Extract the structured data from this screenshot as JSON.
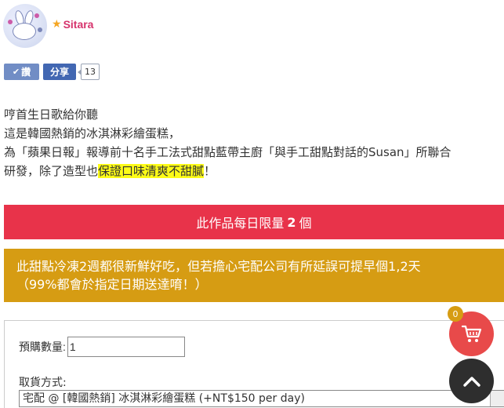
{
  "user": {
    "name": "Sitara"
  },
  "social": {
    "like_label": "讚",
    "share_label": "分享",
    "share_count": "13"
  },
  "description": {
    "line1": "哼首生日歌給你聽",
    "line2": "這是韓國熱銷的冰淇淋彩繪蛋糕，",
    "line3": "為「蘋果日報」報導前十名手工法式甜點藍帶主廚「與手工甜點對話的Susan」所聯合",
    "line4_prefix": "研發，除了造型也",
    "line4_highlight": "保證口味清爽不甜膩",
    "line4_suffix": "！"
  },
  "limit_banner": {
    "prefix": "此作品每日限量",
    "count": "2",
    "suffix": "個"
  },
  "notice_banner": {
    "line1": "此甜點冷凍2週都很新鮮好吃，但若擔心宅配公司有所延誤可提早個1,2天",
    "line2": "（99%都會於指定日期送達唷！）"
  },
  "order": {
    "qty_label": "預購數量:",
    "qty_value": "1",
    "pickup_label": "取貨方式:",
    "pickup_selected": "宅配 @ [韓國熱銷] 冰淇淋彩繪蛋糕 (+NT$150 per day)"
  },
  "cart": {
    "count": "0"
  },
  "colors": {
    "red": "#e8334a",
    "gold": "#d69c13",
    "facebook": "#4267b2",
    "highlight": "#fdfc17"
  },
  "icons": [
    "star-icon",
    "check-icon",
    "cart-icon",
    "chevron-up-icon"
  ]
}
